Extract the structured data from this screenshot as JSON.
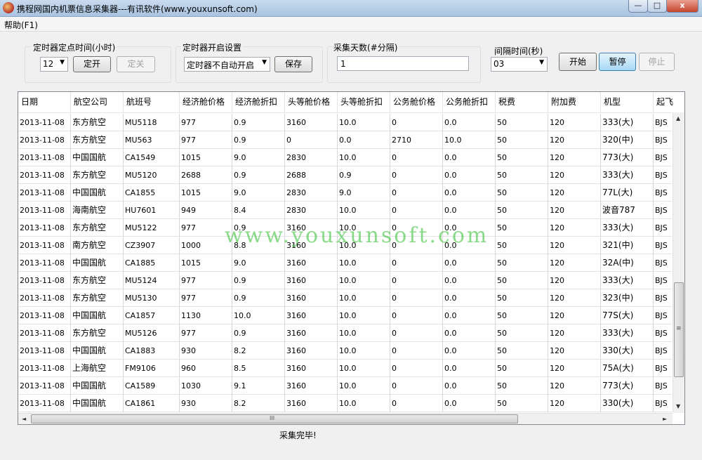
{
  "window": {
    "title": "携程网国内机票信息采集器---有讯软件(www.youxunsoft.com)",
    "min_glyph": "—",
    "max_glyph": "□",
    "close_glyph": "x"
  },
  "menu": {
    "help": "帮助(F1)"
  },
  "timer_fixed": {
    "label": "定时器定点时间(小时)",
    "hour_value": "12",
    "on_button": "定开",
    "off_button": "定关"
  },
  "timer_start": {
    "label": "定时器开启设置",
    "mode_value": "定时器不自动开启",
    "save_button": "保存"
  },
  "days": {
    "label": "采集天数(#分隔)",
    "value": "1"
  },
  "interval": {
    "label": "间隔时间(秒)",
    "value": "03"
  },
  "actions": {
    "start": "开始",
    "pause": "暂停",
    "stop": "停止"
  },
  "table": {
    "columns": [
      "日期",
      "航空公司",
      "航班号",
      "经济舱价格",
      "经济舱折扣",
      "头等舱价格",
      "头等舱折扣",
      "公务舱价格",
      "公务舱折扣",
      "税费",
      "附加费",
      "机型",
      "起飞"
    ],
    "rows": [
      [
        "2013-11-08",
        "东方航空",
        "MU5118",
        "977",
        "0.9",
        "3160",
        "10.0",
        "0",
        "0.0",
        "50",
        "120",
        "333(大)",
        "BJS"
      ],
      [
        "2013-11-08",
        "东方航空",
        "MU563",
        "977",
        "0.9",
        "0",
        "0.0",
        "2710",
        "10.0",
        "50",
        "120",
        "320(中)",
        "BJS"
      ],
      [
        "2013-11-08",
        "中国国航",
        "CA1549",
        "1015",
        "9.0",
        "2830",
        "10.0",
        "0",
        "0.0",
        "50",
        "120",
        "773(大)",
        "BJS"
      ],
      [
        "2013-11-08",
        "东方航空",
        "MU5120",
        "2688",
        "0.9",
        "2688",
        "0.9",
        "0",
        "0.0",
        "50",
        "120",
        "333(大)",
        "BJS"
      ],
      [
        "2013-11-08",
        "中国国航",
        "CA1855",
        "1015",
        "9.0",
        "2830",
        "9.0",
        "0",
        "0.0",
        "50",
        "120",
        "77L(大)",
        "BJS"
      ],
      [
        "2013-11-08",
        "海南航空",
        "HU7601",
        "949",
        "8.4",
        "2830",
        "10.0",
        "0",
        "0.0",
        "50",
        "120",
        "波音787",
        "BJS"
      ],
      [
        "2013-11-08",
        "东方航空",
        "MU5122",
        "977",
        "0.9",
        "3160",
        "10.0",
        "0",
        "0.0",
        "50",
        "120",
        "333(大)",
        "BJS"
      ],
      [
        "2013-11-08",
        "南方航空",
        "CZ3907",
        "1000",
        "8.8",
        "3160",
        "10.0",
        "0",
        "0.0",
        "50",
        "120",
        "321(中)",
        "BJS"
      ],
      [
        "2013-11-08",
        "中国国航",
        "CA1885",
        "1015",
        "9.0",
        "3160",
        "10.0",
        "0",
        "0.0",
        "50",
        "120",
        "32A(中)",
        "BJS"
      ],
      [
        "2013-11-08",
        "东方航空",
        "MU5124",
        "977",
        "0.9",
        "3160",
        "10.0",
        "0",
        "0.0",
        "50",
        "120",
        "333(大)",
        "BJS"
      ],
      [
        "2013-11-08",
        "东方航空",
        "MU5130",
        "977",
        "0.9",
        "3160",
        "10.0",
        "0",
        "0.0",
        "50",
        "120",
        "323(中)",
        "BJS"
      ],
      [
        "2013-11-08",
        "中国国航",
        "CA1857",
        "1130",
        "10.0",
        "3160",
        "10.0",
        "0",
        "0.0",
        "50",
        "120",
        "77S(大)",
        "BJS"
      ],
      [
        "2013-11-08",
        "东方航空",
        "MU5126",
        "977",
        "0.9",
        "3160",
        "10.0",
        "0",
        "0.0",
        "50",
        "120",
        "333(大)",
        "BJS"
      ],
      [
        "2013-11-08",
        "中国国航",
        "CA1883",
        "930",
        "8.2",
        "3160",
        "10.0",
        "0",
        "0.0",
        "50",
        "120",
        "330(大)",
        "BJS"
      ],
      [
        "2013-11-08",
        "上海航空",
        "FM9106",
        "960",
        "8.5",
        "3160",
        "10.0",
        "0",
        "0.0",
        "50",
        "120",
        "75A(大)",
        "BJS"
      ],
      [
        "2013-11-08",
        "中国国航",
        "CA1589",
        "1030",
        "9.1",
        "3160",
        "10.0",
        "0",
        "0.0",
        "50",
        "120",
        "773(大)",
        "BJS"
      ],
      [
        "2013-11-08",
        "中国国航",
        "CA1861",
        "930",
        "8.2",
        "3160",
        "10.0",
        "0",
        "0.0",
        "50",
        "120",
        "330(大)",
        "BJS"
      ]
    ]
  },
  "scroll_glyphs": {
    "up": "▲",
    "down": "▼",
    "left": "◄",
    "right": "►",
    "v_grip": "≡",
    "h_grip": "III"
  },
  "watermark": "www.youxunsoft.com",
  "status": "采集完毕!"
}
